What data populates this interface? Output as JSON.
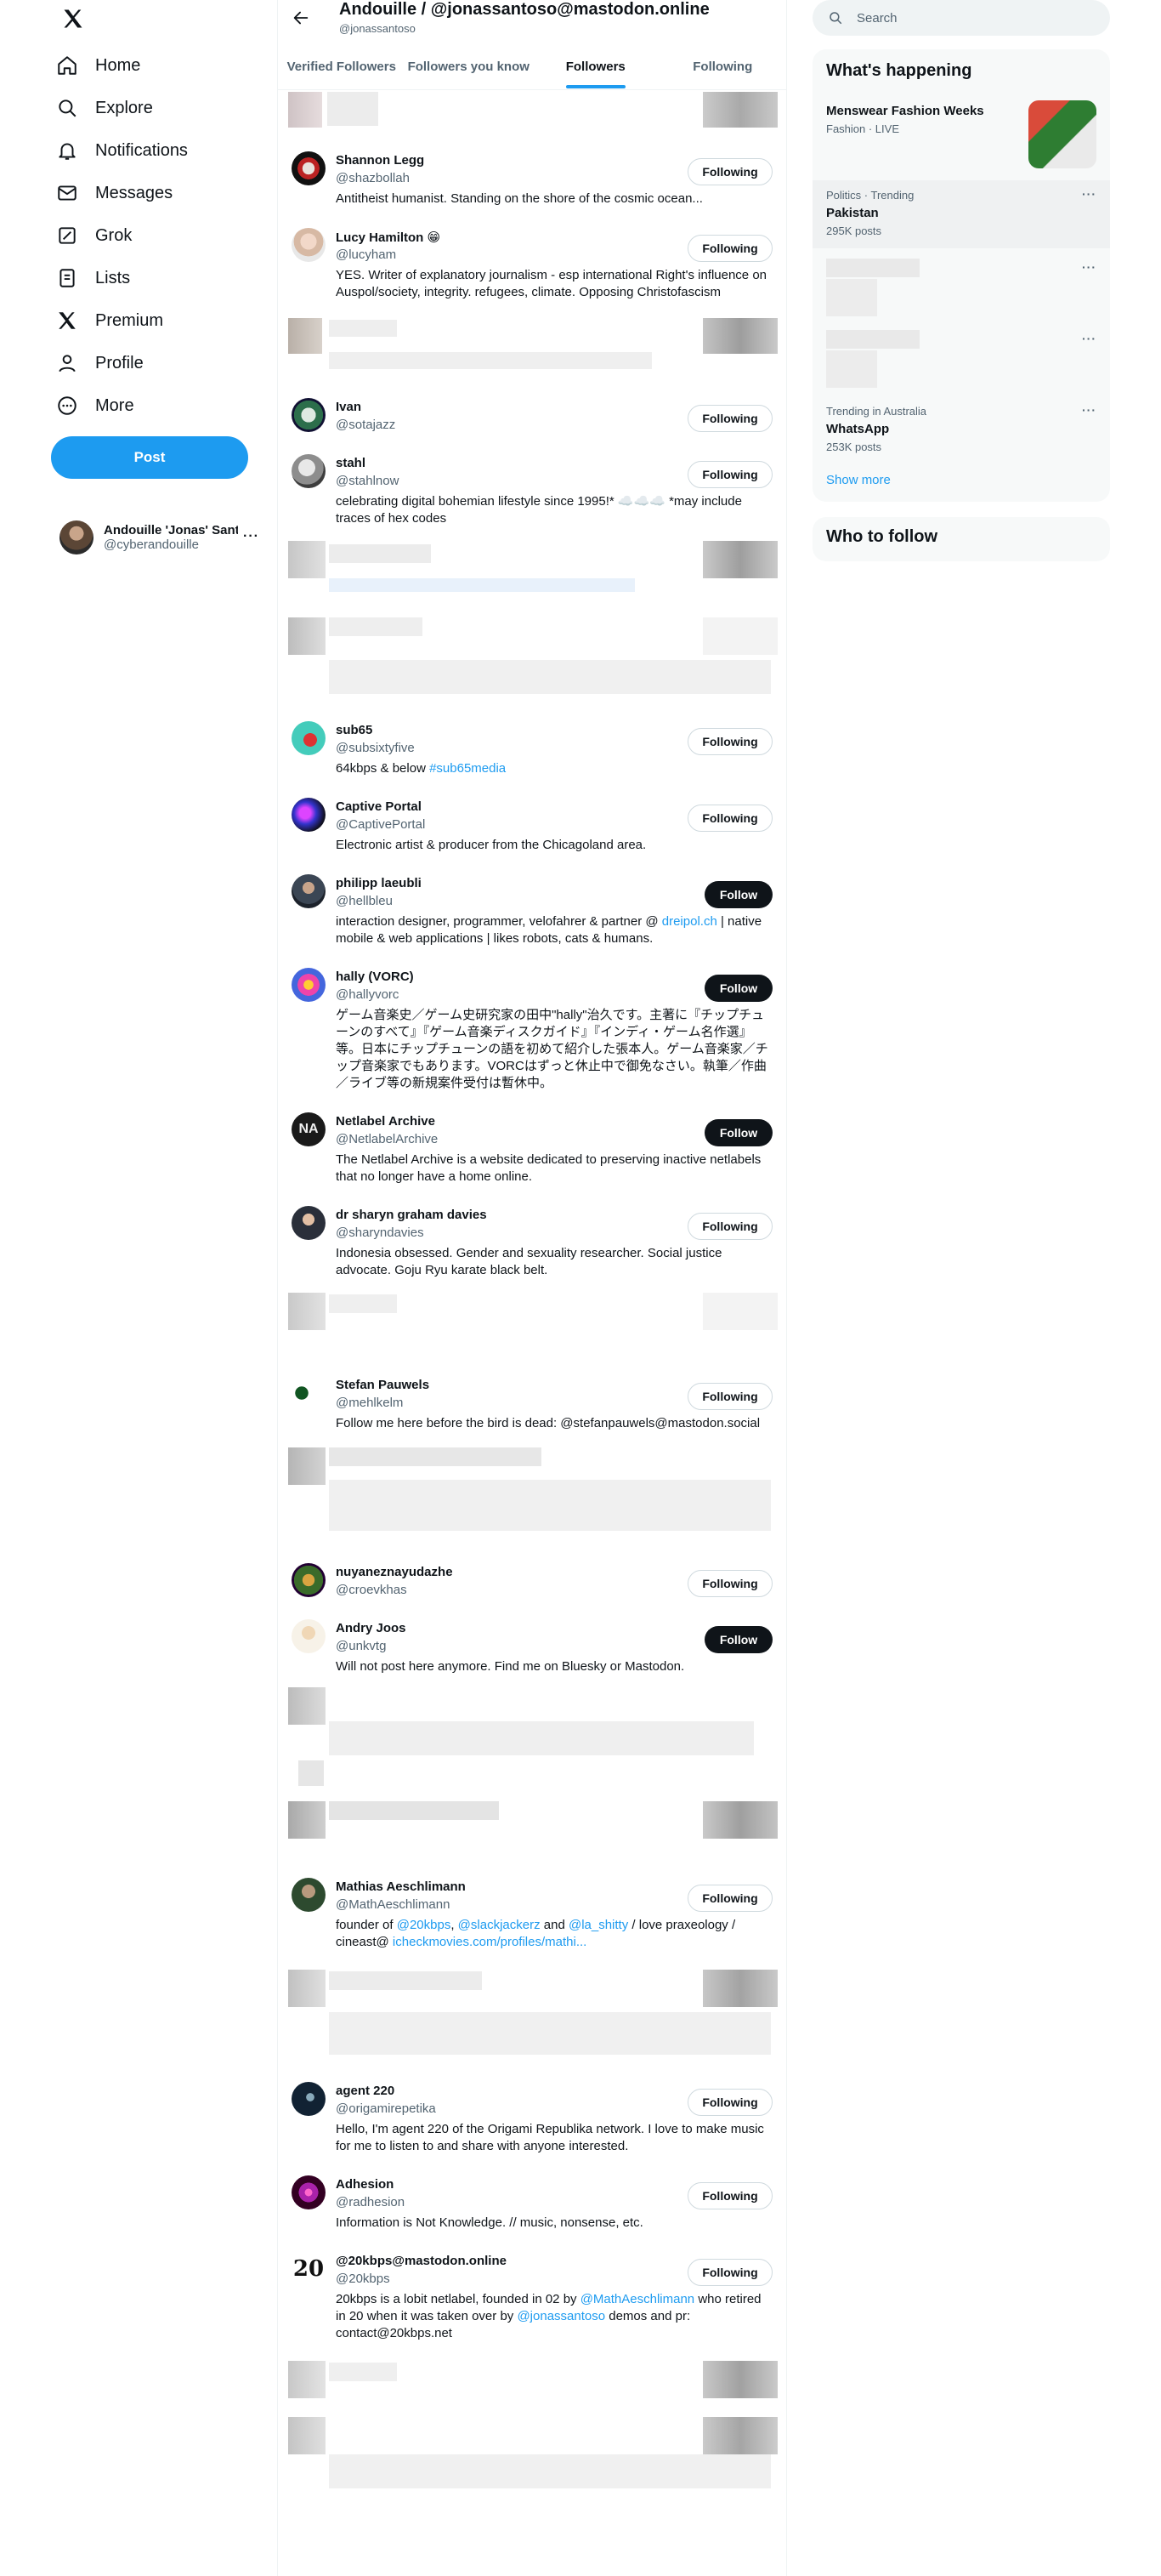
{
  "nav": {
    "items": [
      {
        "label": "Home",
        "icon": "home-icon"
      },
      {
        "label": "Explore",
        "icon": "search-icon"
      },
      {
        "label": "Notifications",
        "icon": "bell-icon"
      },
      {
        "label": "Messages",
        "icon": "mail-icon"
      },
      {
        "label": "Grok",
        "icon": "grok-icon"
      },
      {
        "label": "Lists",
        "icon": "list-icon"
      },
      {
        "label": "Premium",
        "icon": "x-logo-icon"
      },
      {
        "label": "Profile",
        "icon": "person-icon"
      },
      {
        "label": "More",
        "icon": "more-circle-icon"
      }
    ],
    "post_label": "Post",
    "account": {
      "name": "Andouille 'Jonas' Sant",
      "handle": "@cyberandouille"
    }
  },
  "header": {
    "title": "Andouille / @jonassantoso@mastodon.online",
    "subtitle": "@jonassantoso",
    "tabs": [
      {
        "label": "Verified Followers",
        "active": false
      },
      {
        "label": "Followers you know",
        "active": false
      },
      {
        "label": "Followers",
        "active": true
      },
      {
        "label": "Following",
        "active": false
      }
    ]
  },
  "followers": [
    {
      "name": "Shannon Legg",
      "handle": "@shazbollah",
      "bio": "Antitheist humanist. Standing on the shore of the cosmic ocean...",
      "button": "Following"
    },
    {
      "name": "Lucy Hamilton 😁",
      "handle": "@lucyham",
      "bio": "YES. Writer of explanatory journalism - esp international Right's influence on Auspol/society, integrity. refugees, climate. Opposing Christofascism",
      "button": "Following"
    },
    {
      "name": "Ivan",
      "handle": "@sotajazz",
      "bio": "",
      "button": "Following"
    },
    {
      "name": "stahl",
      "handle": "@stahlnow",
      "bio": "celebrating digital bohemian lifestyle since 1995!* ☁️☁️☁️ *may include traces of hex codes",
      "button": "Following"
    },
    {
      "name": "sub65",
      "handle": "@subsixtyfive",
      "bio": "64kbps & below ",
      "bio_link": "#sub65media",
      "button": "Following"
    },
    {
      "name": "Captive Portal",
      "handle": "@CaptivePortal",
      "bio": "Electronic artist & producer from the Chicagoland area.",
      "button": "Following"
    },
    {
      "name": "philipp laeubli",
      "handle": "@hellbleu",
      "bio": "interaction designer, programmer, velofahrer & partner @ ",
      "bio_link": "dreipol.ch",
      "bio_after": " | native mobile & web applications | likes robots, cats & humans.",
      "button": "Follow"
    },
    {
      "name": "hally (VORC)",
      "handle": "@hallyvorc",
      "bio": "ゲーム音楽史／ゲーム史研究家の田中\"hally\"治久です。主著に『チップチューンのすべて』『ゲーム音楽ディスクガイド』『インディ・ゲーム名作選』等。日本にチップチューンの語を初めて紹介した張本人。ゲーム音楽家／チップ音楽家でもあります。VORCはずっと休止中で御免なさい。執筆／作曲／ライブ等の新規案件受付は暫休中。",
      "button": "Follow"
    },
    {
      "name": "Netlabel Archive",
      "handle": "@NetlabelArchive",
      "bio": "The Netlabel Archive is a website dedicated to preserving inactive netlabels that no longer have a home online.",
      "button": "Follow"
    },
    {
      "name": "dr sharyn graham davies",
      "handle": "@sharyndavies",
      "bio": "Indonesia obsessed. Gender and sexuality researcher. Social justice advocate. Goju Ryu karate black belt.",
      "button": "Following"
    },
    {
      "name": "Stefan Pauwels",
      "handle": "@mehlkelm",
      "bio": "Follow me here before the bird is dead: @stefanpauwels@mastodon.social",
      "button": "Following"
    },
    {
      "name": "nuyaneznayudazhe",
      "handle": "@croevkhas",
      "bio": "",
      "button": "Following"
    },
    {
      "name": "Andry Joos",
      "handle": "@unkvtg",
      "bio": "Will not post here anymore. Find me on Bluesky or Mastodon.",
      "button": "Follow"
    },
    {
      "name": "Mathias Aeschlimann",
      "handle": "@MathAeschlimann",
      "bio_parts": [
        "founder of ",
        "@20kbps",
        ", ",
        "@slackjackerz",
        " and ",
        "@la_shitty",
        " / love praxeology / cineast@ ",
        "icheckmovies.com/profiles/mathi..."
      ],
      "button": "Following"
    },
    {
      "name": "agent 220",
      "handle": "@origamirepetika",
      "bio": "Hello, I'm agent 220 of the Origami Republika network. I love to make music for me to listen to and share with anyone interested.",
      "button": "Following"
    },
    {
      "name": "Adhesion",
      "handle": "@radhesion",
      "bio": "Information is Not Knowledge. // music, nonsense, etc.",
      "button": "Following"
    },
    {
      "name": "@20kbps@mastodon.online",
      "handle": "@20kbps",
      "bio_parts": [
        "20kbps is a lobit netlabel, founded in 02 by ",
        "@MathAeschlimann",
        " who retired in 20 when it was taken over by ",
        "@jonassantoso",
        " demos and pr: contact@20kbps.net"
      ],
      "button": "Following",
      "avatar_text": "20"
    }
  ],
  "sidebar": {
    "search_placeholder": "Search",
    "happening_title": "What's happening",
    "trends": [
      {
        "meta": "",
        "name": "Menswear Fashion Weeks",
        "count": "Fashion · LIVE"
      },
      {
        "meta": "Politics · Trending",
        "name": "Pakistan",
        "count": "295K posts"
      },
      {
        "meta": "Trending in Australia",
        "name": "WhatsApp",
        "count": "253K posts"
      }
    ],
    "show_more": "Show more",
    "who_to_follow": "Who to follow"
  },
  "colors": {
    "accent": "#1d9bf0",
    "text": "#0f1419",
    "muted": "#536471",
    "border": "#eff3f4"
  }
}
